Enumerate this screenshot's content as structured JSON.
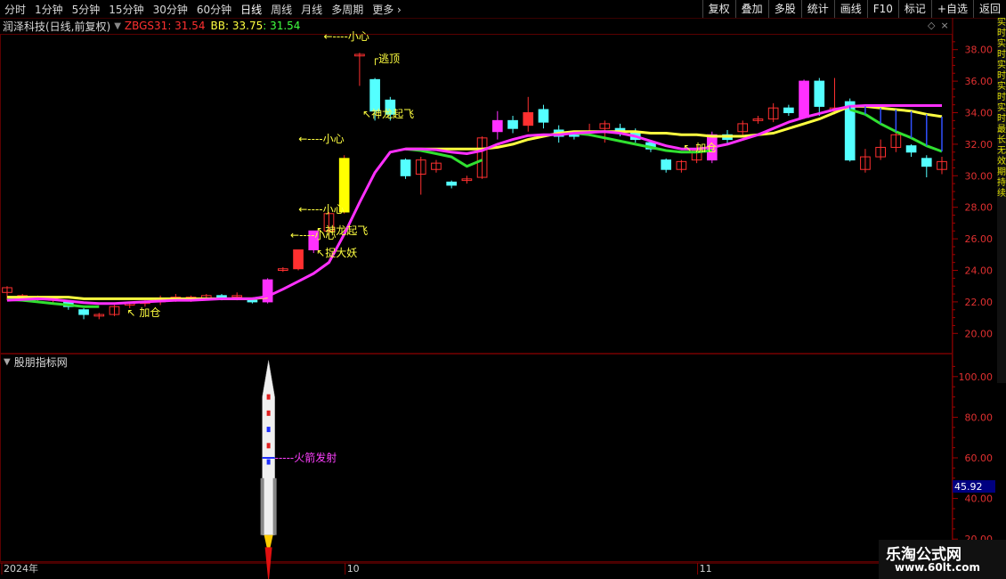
{
  "toolbar": {
    "left": [
      "分时",
      "1分钟",
      "5分钟",
      "15分钟",
      "30分钟",
      "60分钟",
      "日线",
      "周线",
      "月线",
      "多周期",
      "更多"
    ],
    "right": [
      "复权",
      "叠加",
      "多股",
      "统计",
      "画线",
      "F10",
      "标记",
      "+自选",
      "返回"
    ],
    "active": "日线"
  },
  "header": {
    "title": "润泽科技(日线,前复权)",
    "zb": "ZBGS31: 31.54",
    "bb": "BB: 33.75",
    "bb2": ": 31.54"
  },
  "panel2": {
    "title": "股朋指标网",
    "current_value": "45.92",
    "rocket_label": "-----火箭发射"
  },
  "time_axis": {
    "labels": [
      "2024年",
      "10",
      "11"
    ]
  },
  "watermark": {
    "line1": "乐淘公式网",
    "line2": "www.60lt.com"
  },
  "side_text": "实时实时实时实时实时最长无效期持续",
  "annotations": {
    "jiacang": "加仓",
    "xiaoxin": "小心",
    "taoding": "逃顶",
    "shenlong": "神龙起飞",
    "zhuoyao": "捉大妖"
  },
  "colors": {
    "up": "#ff3030",
    "down": "#54ffff",
    "bull": "#ff30ff",
    "bear": "#00d8ff",
    "bbline": "#ffff40",
    "green": "#30e030",
    "magenta": "#ff30ff"
  },
  "chart_data": [
    {
      "type": "candlestick",
      "title": "润泽科技(日线,前复权)",
      "ylim": [
        19,
        39
      ],
      "yticks": [
        20,
        22,
        24,
        26,
        28,
        30,
        32,
        34,
        36,
        38
      ],
      "candles": [
        [
          22.6,
          22.9,
          22.1,
          23.0
        ],
        [
          22.3,
          22.4,
          22.1,
          22.5
        ],
        [
          22.2,
          22.3,
          22.0,
          22.4
        ],
        [
          22.1,
          22.2,
          21.9,
          22.3
        ],
        [
          22.0,
          21.7,
          21.5,
          22.1
        ],
        [
          21.5,
          21.2,
          20.9,
          21.6
        ],
        [
          21.1,
          21.2,
          20.9,
          21.3
        ],
        [
          21.2,
          21.7,
          21.1,
          21.8
        ],
        [
          21.8,
          21.9,
          21.6,
          22.0
        ],
        [
          21.9,
          22.0,
          21.7,
          22.1
        ],
        [
          22.0,
          22.2,
          21.8,
          22.4
        ],
        [
          22.2,
          22.3,
          22.0,
          22.5
        ],
        [
          22.2,
          22.3,
          22.0,
          22.4
        ],
        [
          22.2,
          22.4,
          22.1,
          22.5
        ],
        [
          22.4,
          22.3,
          22.1,
          22.5
        ],
        [
          22.3,
          22.4,
          22.1,
          22.6
        ],
        [
          22.1,
          22.0,
          21.9,
          22.2
        ],
        [
          22.0,
          23.4,
          21.9,
          23.5
        ],
        [
          24.0,
          24.1,
          23.9,
          24.2
        ],
        [
          24.1,
          25.3,
          24.0,
          25.3
        ],
        [
          25.3,
          26.5,
          25.1,
          26.5
        ],
        [
          26.5,
          27.6,
          26.2,
          27.7
        ],
        [
          27.7,
          31.1,
          27.6,
          31.3
        ],
        [
          37.6,
          37.7,
          35.7,
          37.8
        ],
        [
          36.1,
          34.1,
          33.5,
          36.2
        ],
        [
          34.8,
          33.9,
          33.5,
          35.0
        ],
        [
          31.0,
          30.0,
          29.8,
          31.1
        ],
        [
          30.1,
          31.0,
          28.8,
          31.2
        ],
        [
          30.4,
          30.8,
          30.2,
          31.0
        ],
        [
          29.6,
          29.4,
          29.2,
          29.7
        ],
        [
          29.7,
          29.8,
          29.5,
          30.0
        ],
        [
          29.9,
          32.4,
          29.8,
          32.5
        ],
        [
          32.8,
          33.5,
          32.3,
          34.1
        ],
        [
          33.5,
          33.0,
          32.7,
          33.8
        ],
        [
          33.2,
          34.0,
          32.8,
          35.0
        ],
        [
          34.2,
          33.4,
          33.0,
          34.5
        ],
        [
          32.9,
          32.5,
          32.1,
          33.2
        ],
        [
          32.6,
          32.5,
          32.3,
          32.8
        ],
        [
          32.8,
          32.8,
          32.5,
          33.3
        ],
        [
          33.0,
          33.3,
          32.1,
          33.5
        ],
        [
          33.0,
          32.8,
          32.5,
          33.3
        ],
        [
          32.8,
          32.3,
          32.1,
          33.0
        ],
        [
          32.1,
          31.7,
          31.5,
          32.2
        ],
        [
          31.0,
          30.4,
          30.2,
          31.1
        ],
        [
          30.4,
          30.9,
          30.2,
          31.0
        ],
        [
          31.0,
          31.6,
          30.8,
          32.0
        ],
        [
          31.0,
          32.6,
          30.8,
          32.8
        ],
        [
          32.6,
          32.3,
          32.0,
          32.9
        ],
        [
          32.8,
          33.3,
          32.5,
          33.5
        ],
        [
          33.5,
          33.6,
          33.3,
          33.8
        ],
        [
          33.6,
          34.3,
          33.4,
          34.6
        ],
        [
          34.3,
          34.0,
          33.8,
          34.5
        ],
        [
          36.0,
          33.7,
          33.6,
          36.1
        ],
        [
          36.0,
          34.4,
          33.8,
          36.2
        ],
        [
          34.1,
          34.3,
          33.9,
          36.2
        ],
        [
          34.7,
          31.0,
          30.9,
          34.9
        ],
        [
          30.4,
          31.2,
          30.2,
          31.7
        ],
        [
          31.2,
          31.8,
          31.0,
          32.3
        ],
        [
          31.8,
          32.6,
          31.5,
          33.2
        ],
        [
          31.9,
          31.5,
          31.2,
          32.0
        ],
        [
          31.1,
          30.6,
          29.9,
          31.3
        ],
        [
          30.4,
          30.9,
          30.1,
          31.2
        ]
      ],
      "magenta_line": [
        22.1,
        22.15,
        22.2,
        22.15,
        22.05,
        21.95,
        21.9,
        21.9,
        21.95,
        22.0,
        22.05,
        22.1,
        22.1,
        22.15,
        22.2,
        22.2,
        22.2,
        22.35,
        22.8,
        23.3,
        23.8,
        24.5,
        26.3,
        28.3,
        30.2,
        31.5,
        31.7,
        31.7,
        31.65,
        31.5,
        31.4,
        31.6,
        32.0,
        32.3,
        32.55,
        32.6,
        32.6,
        32.7,
        32.75,
        32.8,
        32.7,
        32.5,
        32.2,
        31.9,
        31.7,
        31.7,
        31.8,
        32.0,
        32.3,
        32.6,
        33.0,
        33.4,
        33.7,
        33.95,
        34.2,
        34.4,
        34.45,
        34.45,
        34.45,
        34.45,
        34.45,
        34.45
      ],
      "yellow_line": [
        22.3,
        22.3,
        22.3,
        22.3,
        22.3,
        22.2,
        22.2,
        22.2,
        22.2,
        22.2,
        22.2,
        22.2,
        22.2,
        22.2,
        22.2,
        22.2,
        22.2,
        22.3,
        null,
        null,
        null,
        null,
        null,
        null,
        null,
        null,
        31.7,
        31.7,
        31.7,
        31.7,
        31.7,
        31.7,
        31.8,
        32.0,
        32.3,
        32.5,
        32.7,
        32.8,
        32.8,
        32.8,
        32.8,
        32.8,
        32.7,
        32.7,
        32.6,
        32.6,
        32.5,
        32.5,
        32.5,
        32.6,
        32.7,
        33.0,
        33.3,
        33.6,
        34.0,
        34.4,
        34.4,
        34.3,
        34.2,
        34.1,
        33.9,
        33.75
      ],
      "green_line": [
        22.15,
        22.1,
        22.0,
        21.9,
        21.8,
        21.7,
        21.7,
        null,
        null,
        null,
        null,
        null,
        null,
        null,
        null,
        null,
        null,
        null,
        null,
        null,
        null,
        null,
        null,
        null,
        null,
        null,
        31.7,
        31.6,
        31.4,
        31.2,
        30.6,
        31.0,
        null,
        null,
        null,
        null,
        null,
        32.7,
        32.6,
        32.4,
        32.2,
        32.0,
        31.8,
        31.6,
        31.5,
        31.5,
        31.6,
        null,
        null,
        null,
        null,
        null,
        null,
        null,
        null,
        34.2,
        33.9,
        33.3,
        32.8,
        32.4,
        31.9,
        31.54
      ]
    },
    {
      "type": "bar",
      "title": "股朋指标网",
      "ylim": [
        10,
        110
      ],
      "yticks": [
        20,
        40,
        60,
        80,
        100
      ],
      "current": 45.92
    }
  ]
}
